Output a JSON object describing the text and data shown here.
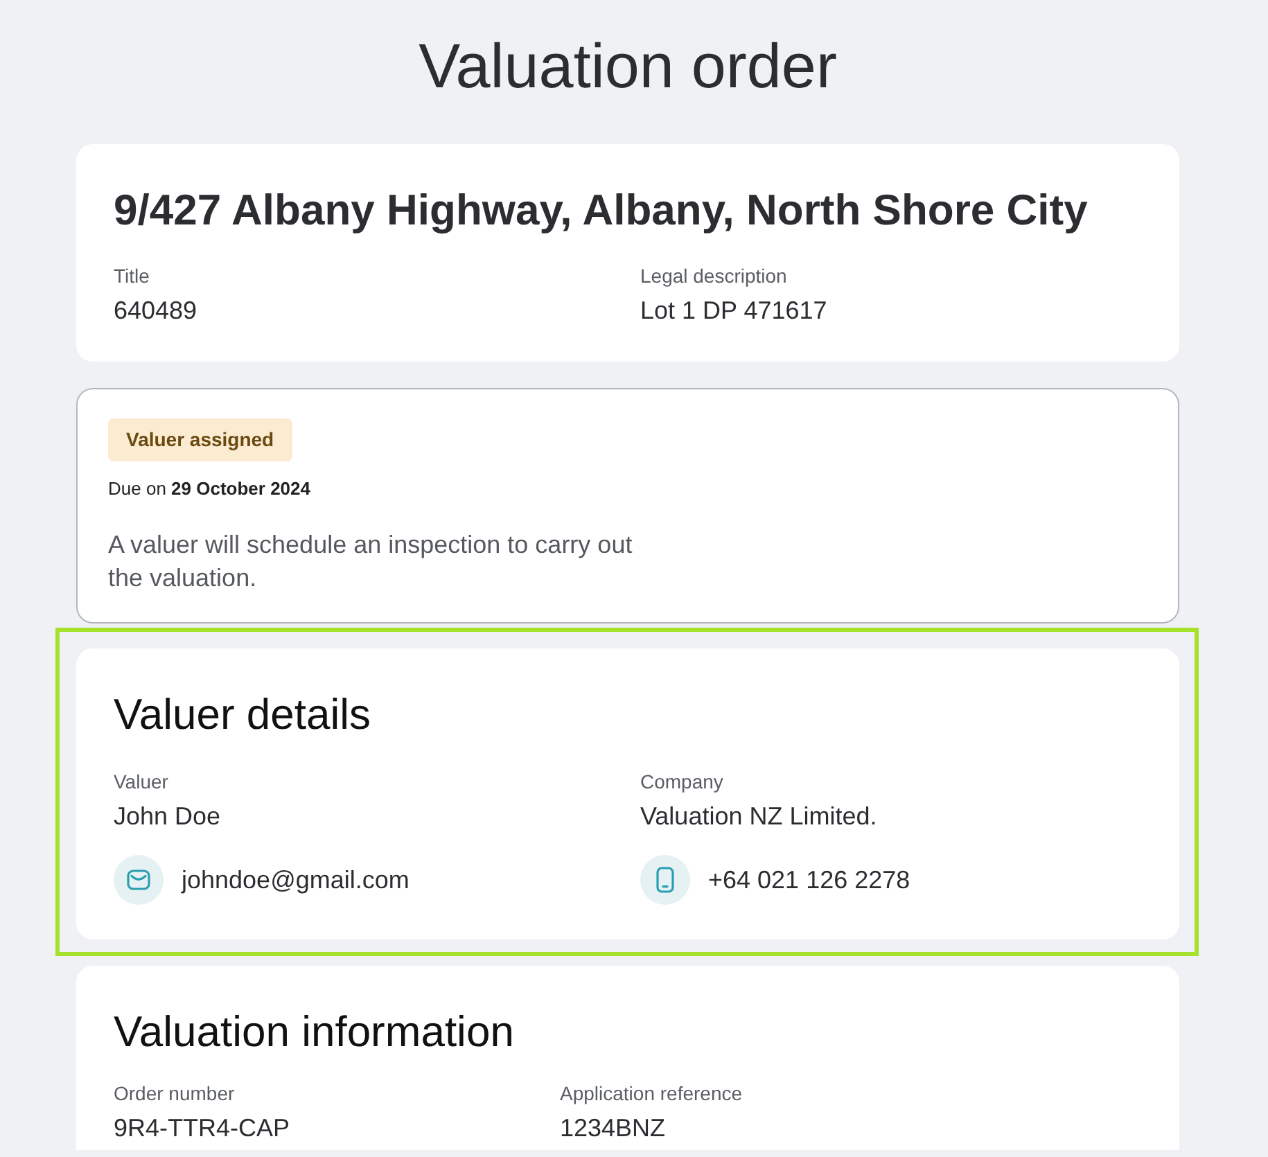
{
  "page": {
    "title": "Valuation order"
  },
  "property": {
    "address": "9/427 Albany Highway, Albany, North Shore City",
    "fields": [
      {
        "label": "Title",
        "value": "640489"
      },
      {
        "label": "Legal description",
        "value": "Lot 1 DP 471617"
      }
    ]
  },
  "status": {
    "badge": "Valuer assigned",
    "due": "Due on **29 October 2024**",
    "message": "A valuer will schedule an inspection to carry out the valuation."
  },
  "valuer_details": {
    "highlighted": true,
    "heading": "Valuer details",
    "fields": [
      {
        "label": "Valuer",
        "value": "John Doe"
      },
      {
        "label": "Company",
        "value": "Valuation NZ Limited."
      }
    ],
    "contacts": [
      {
        "kind": "email",
        "value": "johndoe@gmail.com"
      },
      {
        "kind": "phone",
        "value": "+64 021 126 2278"
      }
    ]
  },
  "valuation_information": {
    "heading": "Valuation information",
    "fields": [
      {
        "label": "Order number",
        "value": "9R4-TTR4-CAP"
      },
      {
        "label": "Application reference",
        "value": "1234BNZ"
      }
    ]
  }
}
